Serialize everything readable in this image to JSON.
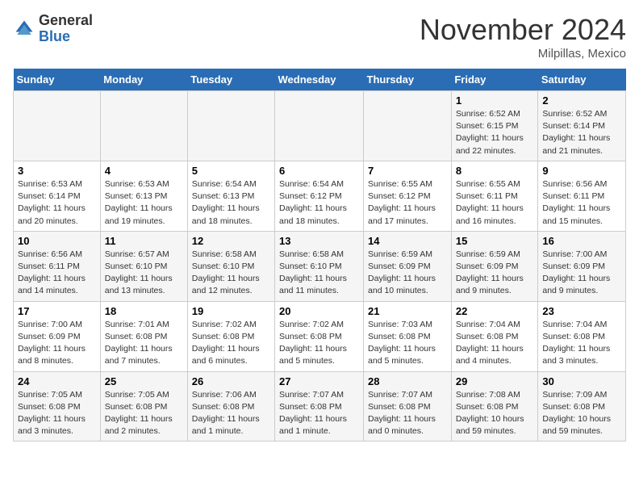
{
  "header": {
    "logo_general": "General",
    "logo_blue": "Blue",
    "month": "November 2024",
    "location": "Milpillas, Mexico"
  },
  "days_of_week": [
    "Sunday",
    "Monday",
    "Tuesday",
    "Wednesday",
    "Thursday",
    "Friday",
    "Saturday"
  ],
  "weeks": [
    [
      {
        "day": "",
        "info": ""
      },
      {
        "day": "",
        "info": ""
      },
      {
        "day": "",
        "info": ""
      },
      {
        "day": "",
        "info": ""
      },
      {
        "day": "",
        "info": ""
      },
      {
        "day": "1",
        "info": "Sunrise: 6:52 AM\nSunset: 6:15 PM\nDaylight: 11 hours and 22 minutes."
      },
      {
        "day": "2",
        "info": "Sunrise: 6:52 AM\nSunset: 6:14 PM\nDaylight: 11 hours and 21 minutes."
      }
    ],
    [
      {
        "day": "3",
        "info": "Sunrise: 6:53 AM\nSunset: 6:14 PM\nDaylight: 11 hours and 20 minutes."
      },
      {
        "day": "4",
        "info": "Sunrise: 6:53 AM\nSunset: 6:13 PM\nDaylight: 11 hours and 19 minutes."
      },
      {
        "day": "5",
        "info": "Sunrise: 6:54 AM\nSunset: 6:13 PM\nDaylight: 11 hours and 18 minutes."
      },
      {
        "day": "6",
        "info": "Sunrise: 6:54 AM\nSunset: 6:12 PM\nDaylight: 11 hours and 18 minutes."
      },
      {
        "day": "7",
        "info": "Sunrise: 6:55 AM\nSunset: 6:12 PM\nDaylight: 11 hours and 17 minutes."
      },
      {
        "day": "8",
        "info": "Sunrise: 6:55 AM\nSunset: 6:11 PM\nDaylight: 11 hours and 16 minutes."
      },
      {
        "day": "9",
        "info": "Sunrise: 6:56 AM\nSunset: 6:11 PM\nDaylight: 11 hours and 15 minutes."
      }
    ],
    [
      {
        "day": "10",
        "info": "Sunrise: 6:56 AM\nSunset: 6:11 PM\nDaylight: 11 hours and 14 minutes."
      },
      {
        "day": "11",
        "info": "Sunrise: 6:57 AM\nSunset: 6:10 PM\nDaylight: 11 hours and 13 minutes."
      },
      {
        "day": "12",
        "info": "Sunrise: 6:58 AM\nSunset: 6:10 PM\nDaylight: 11 hours and 12 minutes."
      },
      {
        "day": "13",
        "info": "Sunrise: 6:58 AM\nSunset: 6:10 PM\nDaylight: 11 hours and 11 minutes."
      },
      {
        "day": "14",
        "info": "Sunrise: 6:59 AM\nSunset: 6:09 PM\nDaylight: 11 hours and 10 minutes."
      },
      {
        "day": "15",
        "info": "Sunrise: 6:59 AM\nSunset: 6:09 PM\nDaylight: 11 hours and 9 minutes."
      },
      {
        "day": "16",
        "info": "Sunrise: 7:00 AM\nSunset: 6:09 PM\nDaylight: 11 hours and 9 minutes."
      }
    ],
    [
      {
        "day": "17",
        "info": "Sunrise: 7:00 AM\nSunset: 6:09 PM\nDaylight: 11 hours and 8 minutes."
      },
      {
        "day": "18",
        "info": "Sunrise: 7:01 AM\nSunset: 6:08 PM\nDaylight: 11 hours and 7 minutes."
      },
      {
        "day": "19",
        "info": "Sunrise: 7:02 AM\nSunset: 6:08 PM\nDaylight: 11 hours and 6 minutes."
      },
      {
        "day": "20",
        "info": "Sunrise: 7:02 AM\nSunset: 6:08 PM\nDaylight: 11 hours and 5 minutes."
      },
      {
        "day": "21",
        "info": "Sunrise: 7:03 AM\nSunset: 6:08 PM\nDaylight: 11 hours and 5 minutes."
      },
      {
        "day": "22",
        "info": "Sunrise: 7:04 AM\nSunset: 6:08 PM\nDaylight: 11 hours and 4 minutes."
      },
      {
        "day": "23",
        "info": "Sunrise: 7:04 AM\nSunset: 6:08 PM\nDaylight: 11 hours and 3 minutes."
      }
    ],
    [
      {
        "day": "24",
        "info": "Sunrise: 7:05 AM\nSunset: 6:08 PM\nDaylight: 11 hours and 3 minutes."
      },
      {
        "day": "25",
        "info": "Sunrise: 7:05 AM\nSunset: 6:08 PM\nDaylight: 11 hours and 2 minutes."
      },
      {
        "day": "26",
        "info": "Sunrise: 7:06 AM\nSunset: 6:08 PM\nDaylight: 11 hours and 1 minute."
      },
      {
        "day": "27",
        "info": "Sunrise: 7:07 AM\nSunset: 6:08 PM\nDaylight: 11 hours and 1 minute."
      },
      {
        "day": "28",
        "info": "Sunrise: 7:07 AM\nSunset: 6:08 PM\nDaylight: 11 hours and 0 minutes."
      },
      {
        "day": "29",
        "info": "Sunrise: 7:08 AM\nSunset: 6:08 PM\nDaylight: 10 hours and 59 minutes."
      },
      {
        "day": "30",
        "info": "Sunrise: 7:09 AM\nSunset: 6:08 PM\nDaylight: 10 hours and 59 minutes."
      }
    ]
  ]
}
